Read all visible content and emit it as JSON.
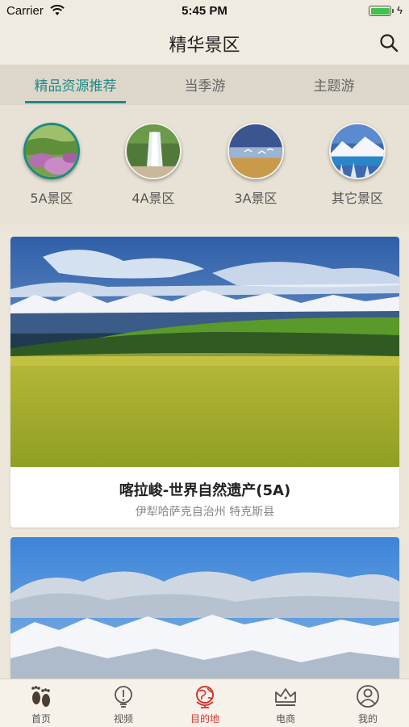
{
  "status_bar": {
    "carrier": "Carrier",
    "time": "5:45 PM"
  },
  "nav": {
    "title": "精华景区",
    "search_icon": "search-icon"
  },
  "tabs": [
    {
      "label": "精品资源推荐",
      "active": true
    },
    {
      "label": "当季游",
      "active": false
    },
    {
      "label": "主题游",
      "active": false
    }
  ],
  "categories": [
    {
      "label": "5A景区",
      "active": true
    },
    {
      "label": "4A景区",
      "active": false
    },
    {
      "label": "3A景区",
      "active": false
    },
    {
      "label": "其它景区",
      "active": false
    }
  ],
  "cards": [
    {
      "title": "喀拉峻-世界自然遗产(5A)",
      "subtitle": "伊犁哈萨克自治州 特克斯县"
    },
    {
      "title": "",
      "subtitle": ""
    }
  ],
  "tabbar": [
    {
      "label": "首页",
      "icon": "footprints-icon",
      "active": false
    },
    {
      "label": "视频",
      "icon": "lightbulb-icon",
      "active": false
    },
    {
      "label": "目的地",
      "icon": "globe-icon",
      "active": true
    },
    {
      "label": "电商",
      "icon": "crown-icon",
      "active": false
    },
    {
      "label": "我的",
      "icon": "user-icon",
      "active": false
    }
  ],
  "colors": {
    "accent": "#1e8a82",
    "active_tab_icon": "#d2342f",
    "background": "#ece6da"
  }
}
